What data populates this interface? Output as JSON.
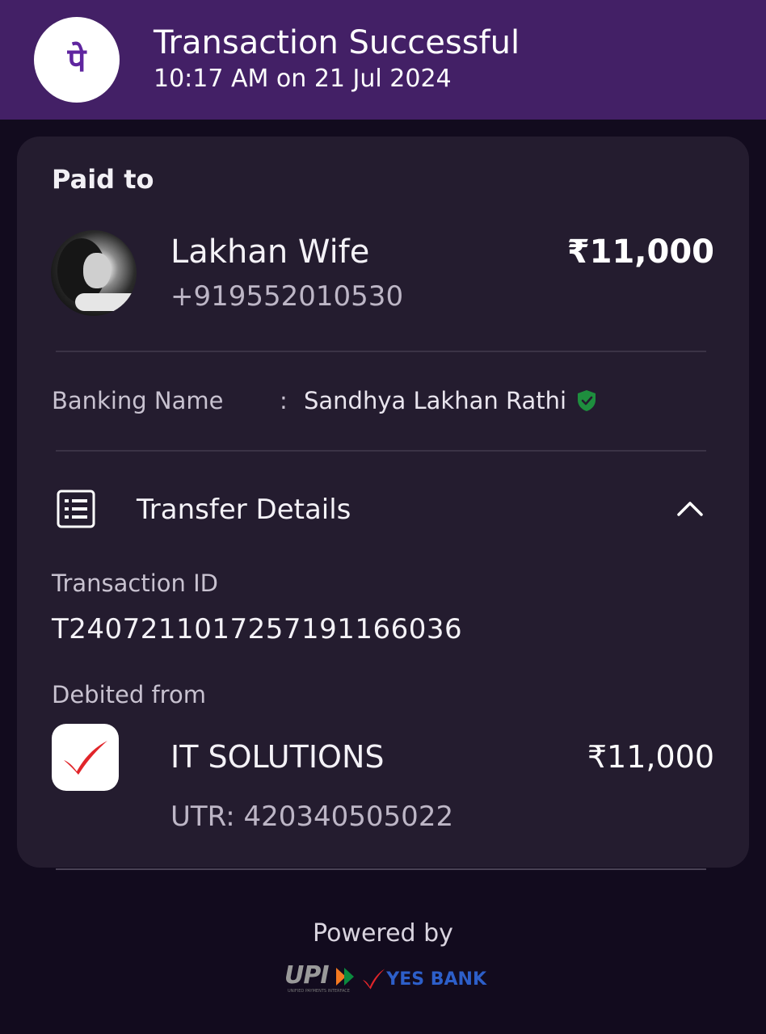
{
  "header": {
    "title": "Transaction Successful",
    "subtitle": "10:17 AM on 21 Jul 2024",
    "logo_glyph": "पे",
    "brand_color": "#432066"
  },
  "payee": {
    "section_label": "Paid to",
    "name": "Lakhan Wife",
    "phone": "+919552010530",
    "amount": "₹11,000"
  },
  "banking": {
    "label": "Banking Name",
    "separator": ":",
    "value": "Sandhya Lakhan Rathi",
    "verified_icon": "shield-check-icon",
    "verified_color": "#1e8e3e"
  },
  "transfer": {
    "title": "Transfer Details",
    "expanded": true,
    "transaction_id_label": "Transaction ID",
    "transaction_id": "T2407211017257191166036",
    "debited_from_label": "Debited from",
    "account_name": "IT SOLUTIONS",
    "account_amount": "₹11,000",
    "utr": "UTR: 420340505022"
  },
  "footer": {
    "powered_by": "Powered by",
    "upi_logo": "UPI",
    "upi_subtext": "UNIFIED PAYMENTS INTERFACE",
    "bank_logo": "YES BANK"
  }
}
